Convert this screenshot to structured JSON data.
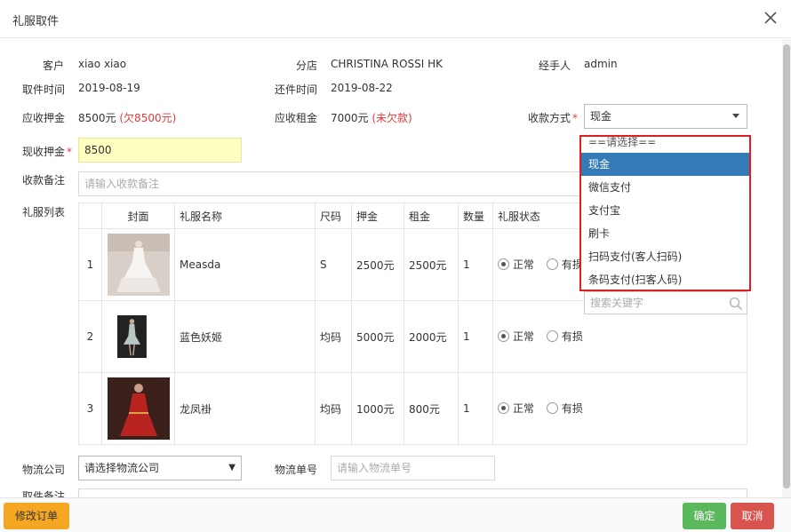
{
  "dialog": {
    "title": "礼服取件"
  },
  "info": {
    "customer_label": "客户",
    "customer": "xiao xiao",
    "branch_label": "分店",
    "branch": "CHRISTINA ROSSI HK",
    "handler_label": "经手人",
    "handler": "admin",
    "pickup_label": "取件时间",
    "pickup": "2019-08-19",
    "return_label": "还件时间",
    "return": "2019-08-22",
    "deposit_label": "应收押金",
    "deposit": "8500元",
    "deposit_owed": "(欠8500元)",
    "rent_label": "应收租金",
    "rent": "7000元",
    "rent_owed": "(未欠款)",
    "pay_method_label": "收款方式",
    "pay_method_value": "现金",
    "cur_deposit_label": "现收押金",
    "cur_deposit_value": "8500",
    "remark_label": "收款备注",
    "remark_placeholder": "请输入收款备注",
    "list_label": "礼服列表"
  },
  "table": {
    "headers": [
      "",
      "封面",
      "礼服名称",
      "尺码",
      "押金",
      "租金",
      "数量",
      "礼服状态"
    ],
    "rows": [
      {
        "no": "1",
        "name": "Measda",
        "size": "S",
        "deposit": "2500元",
        "rent": "2500元",
        "qty": "1",
        "normal": "正常",
        "damaged": "有损"
      },
      {
        "no": "2",
        "name": "蓝色妖姬",
        "size": "均码",
        "deposit": "5000元",
        "rent": "2000元",
        "qty": "1",
        "normal": "正常",
        "damaged": "有损"
      },
      {
        "no": "3",
        "name": "龙凤褂",
        "size": "均码",
        "deposit": "1000元",
        "rent": "800元",
        "qty": "1",
        "normal": "正常",
        "damaged": "有损"
      }
    ]
  },
  "logistics": {
    "company_label": "物流公司",
    "company_value": "请选择物流公司",
    "number_label": "物流单号",
    "number_placeholder": "请输入物流单号",
    "pickup_remark_label": "取件备注"
  },
  "dropdown": {
    "options": [
      "==请选择==",
      "现金",
      "微信支付",
      "支付宝",
      "刷卡",
      "扫码支付(客人扫码)",
      "条码支付(扫客人码)"
    ],
    "selected": "现金",
    "search_placeholder": "搜索关键字"
  },
  "footer": {
    "modify": "修改订单",
    "confirm": "确定",
    "cancel": "取消"
  },
  "colors": {
    "accent_red": "#e4393c",
    "selected_blue": "#337ab7",
    "orange": "#f5a623",
    "green": "#5cb85c",
    "danger": "#d9534f"
  }
}
